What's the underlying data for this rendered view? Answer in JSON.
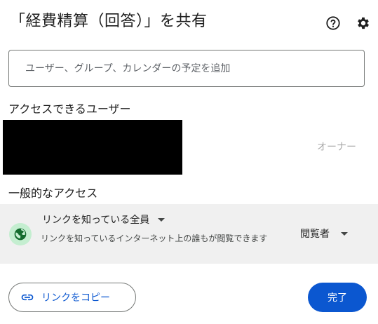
{
  "dialog": {
    "title": "「経費精算（回答）」を共有"
  },
  "search": {
    "placeholder": "ユーザー、グループ、カレンダーの予定を追加"
  },
  "access_section": {
    "heading": "アクセスできるユーザー",
    "users": [
      {
        "role": "オーナー"
      }
    ]
  },
  "general_access": {
    "heading": "一般的なアクセス",
    "scope": "リンクを知っている全員",
    "description": "リンクを知っているインターネット上の誰もが閲覧できます",
    "role": "閲覧者"
  },
  "footer": {
    "copy_link": "リンクをコピー",
    "done": "完了"
  },
  "colors": {
    "primary": "#0b57d0",
    "globe_bg": "#c4eed0",
    "globe_fg": "#146c2e",
    "panel_bg": "#f0f0f0"
  }
}
